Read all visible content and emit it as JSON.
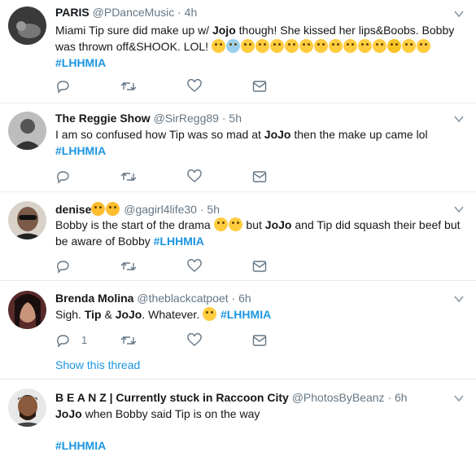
{
  "tweets": [
    {
      "name": "PARIS",
      "handle": "@PDanceMusic",
      "time": "4h",
      "text_a": "Miami Tip sure did make up w/ ",
      "bold1": "Jojo",
      "text_b": " though! She kissed her lips&Boobs. Bobby",
      "line2": "was thrown off&SHOOK. LOL! ",
      "emoji_desc": "laughing, sweating, kissing, tongue-out emojis",
      "hashtag": "#LHHMIA"
    },
    {
      "name": "The Reggie Show",
      "handle": "@SirRegg89",
      "time": "5h",
      "text_a": "I am so confused how Tip was so mad at ",
      "bold1": "JoJo",
      "text_b": " then the make up came lol",
      "hashtag": "#LHHMIA"
    },
    {
      "name": "denise",
      "handle": "@gagirl4life30",
      "time": "5h",
      "text_a": "Bobby is the start of the drama ",
      "text_b": " but ",
      "bold1": "JoJo",
      "text_c": " and Tip did squash their beef but",
      "line2": "be aware of Bobby ",
      "hashtag": "#LHHMIA"
    },
    {
      "name": "Brenda Molina",
      "handle": "@theblackcatpoet",
      "time": "6h",
      "text_a": "Sigh. ",
      "bold1": "Tip",
      "text_b": " & ",
      "bold2": "JoJo",
      "text_c": ". Whatever. ",
      "hashtag": "#LHHMIA",
      "reply_count": "1",
      "show_thread": "Show this thread"
    },
    {
      "name": "B E A N Z | Currently stuck in Raccoon City",
      "handle": "@PhotosByBeanz",
      "time": "6h",
      "bold1": "JoJo",
      "text_a": " when Bobby said Tip is on the way",
      "hashtag": "#LHHMIA"
    }
  ],
  "separator": "·",
  "icons": [
    "reply-icon",
    "retweet-icon",
    "like-icon",
    "dm-icon",
    "caret-down-icon"
  ],
  "colors": {
    "link": "#1b95e0",
    "muted": "#657786",
    "divider": "#e6ecf0"
  }
}
